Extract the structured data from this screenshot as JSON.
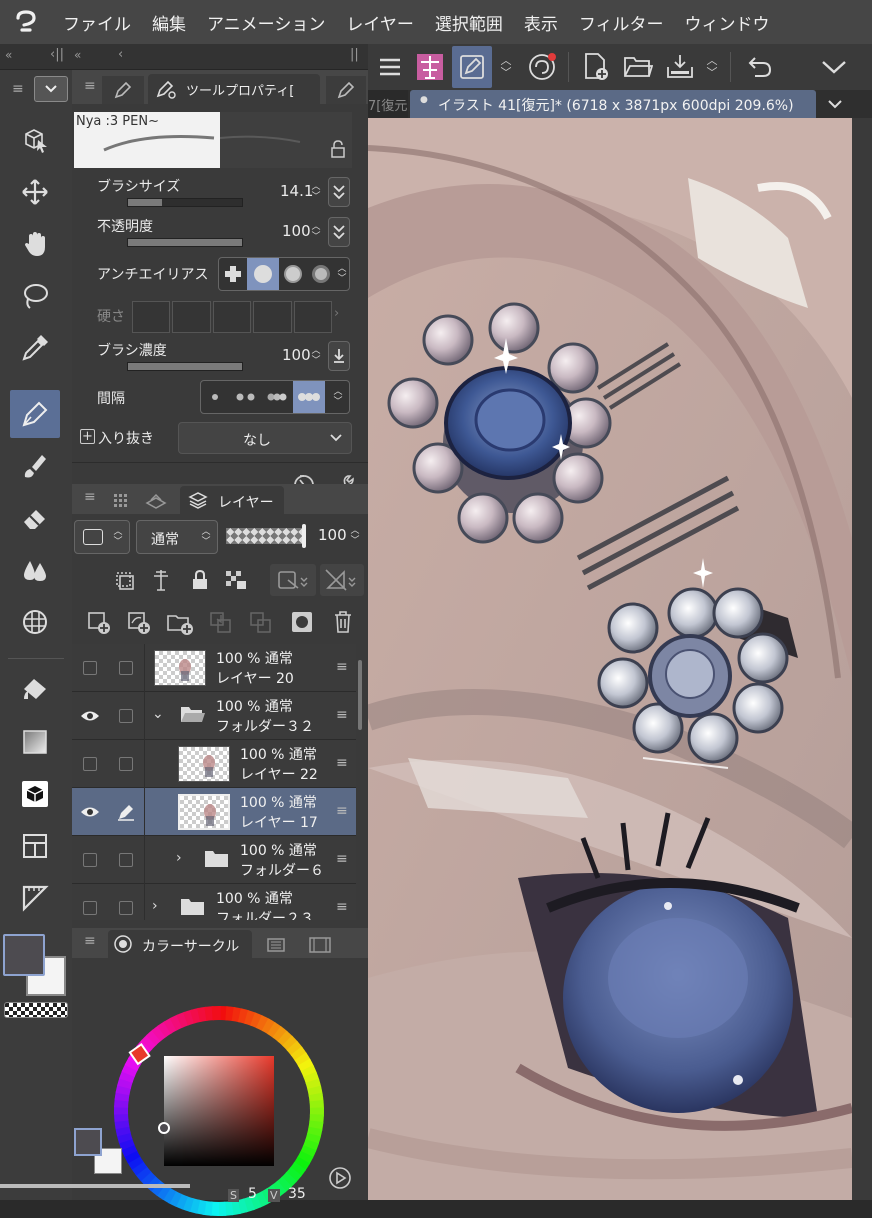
{
  "menubar": {
    "items": [
      "ファイル",
      "編集",
      "アニメーション",
      "レイヤー",
      "選択範囲",
      "表示",
      "フィルター",
      "ウィンドウ"
    ]
  },
  "tool_property": {
    "tab_label": "ツールプロパティ[",
    "brush_name": "Nya :3 PEN~",
    "brush_size_label": "ブラシサイズ",
    "brush_size_value": "14.1",
    "brush_size_fraction": 0.3,
    "opacity_label": "不透明度",
    "opacity_value": "100",
    "opacity_fraction": 1.0,
    "antialias_label": "アンチエイリアス",
    "hardness_label": "硬さ",
    "density_label": "ブラシ濃度",
    "density_value": "100",
    "density_fraction": 1.0,
    "spacing_label": "間隔",
    "in_out_label": "入り抜き",
    "in_out_value": "なし"
  },
  "layer_panel": {
    "tab_label": "レイヤー",
    "blend_mode": "通常",
    "opacity_value": "100",
    "layers": [
      {
        "opacity": "100 %",
        "blend": "通常",
        "name": "レイヤー 20",
        "visible": false,
        "type": "layer",
        "indent": 0,
        "selected": false
      },
      {
        "opacity": "100 %",
        "blend": "通常",
        "name": "フォルダー３２",
        "visible": true,
        "type": "folder-open",
        "indent": 0,
        "selected": false
      },
      {
        "opacity": "100 %",
        "blend": "通常",
        "name": "レイヤー 22",
        "visible": false,
        "type": "layer",
        "indent": 1,
        "selected": false
      },
      {
        "opacity": "100 %",
        "blend": "通常",
        "name": "レイヤー 17",
        "visible": true,
        "type": "layer",
        "indent": 1,
        "selected": true
      },
      {
        "opacity": "100 %",
        "blend": "通常",
        "name": "フォルダー６",
        "visible": false,
        "type": "folder-closed",
        "indent": 1,
        "selected": false
      },
      {
        "opacity": "100 %",
        "blend": "通常",
        "name": "フォルダー２３",
        "visible": false,
        "type": "folder-closed",
        "indent": 0,
        "selected": false
      }
    ]
  },
  "color_panel": {
    "tab_label": "カラーサークル",
    "s_value": "5",
    "v_label": "V",
    "v_value": "35",
    "main_color": "#4d4b50",
    "sub_color": "#f4f4f4",
    "hue_color": "#e8392b"
  },
  "document": {
    "prev_tab_label": "7[復元",
    "tab_label": "イラスト 41[復元]* (6718 x 3871px 600dpi 209.6%)"
  },
  "colors": {
    "accent": "#5b6f96",
    "panel_bg": "#3a3a3a",
    "menubar_bg": "#464646"
  }
}
